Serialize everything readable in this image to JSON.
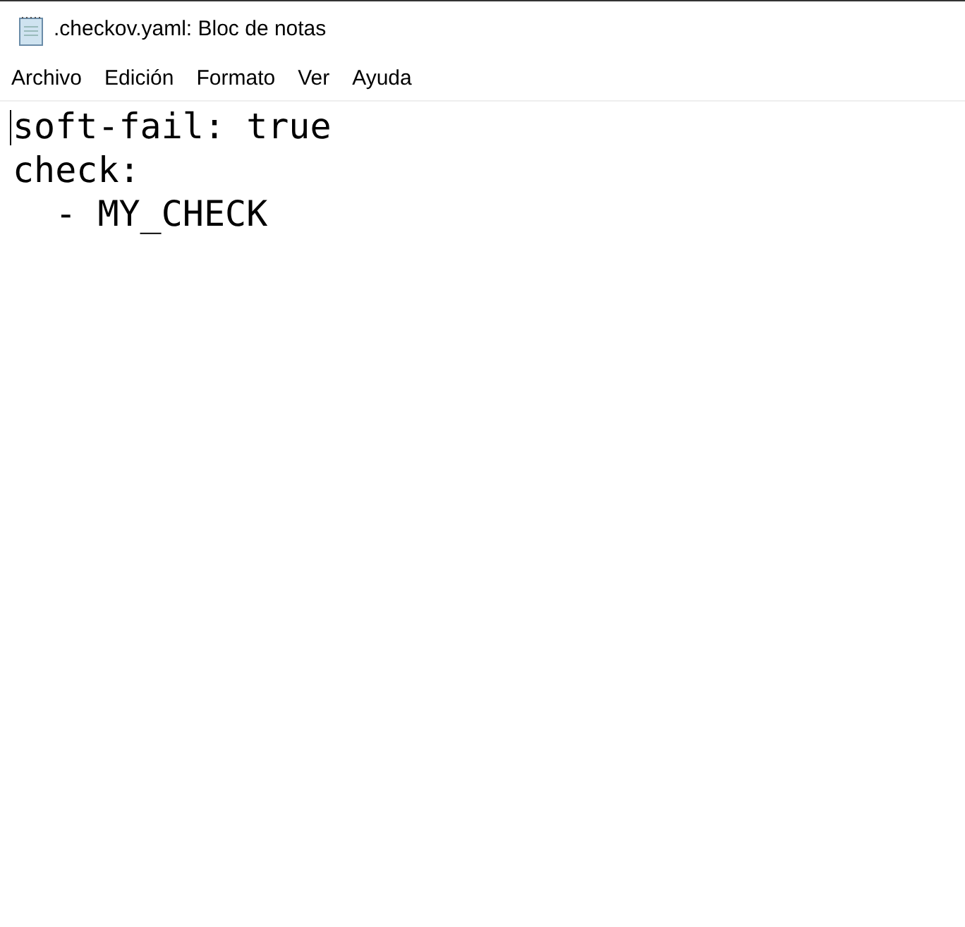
{
  "window": {
    "title": ".checkov.yaml: Bloc de notas"
  },
  "menu": [
    "Archivo",
    "Edición",
    "Formato",
    "Ver",
    "Ayuda"
  ],
  "editor": {
    "lines": [
      "soft-fail: true",
      "check:",
      "  - MY_CHECK"
    ]
  }
}
